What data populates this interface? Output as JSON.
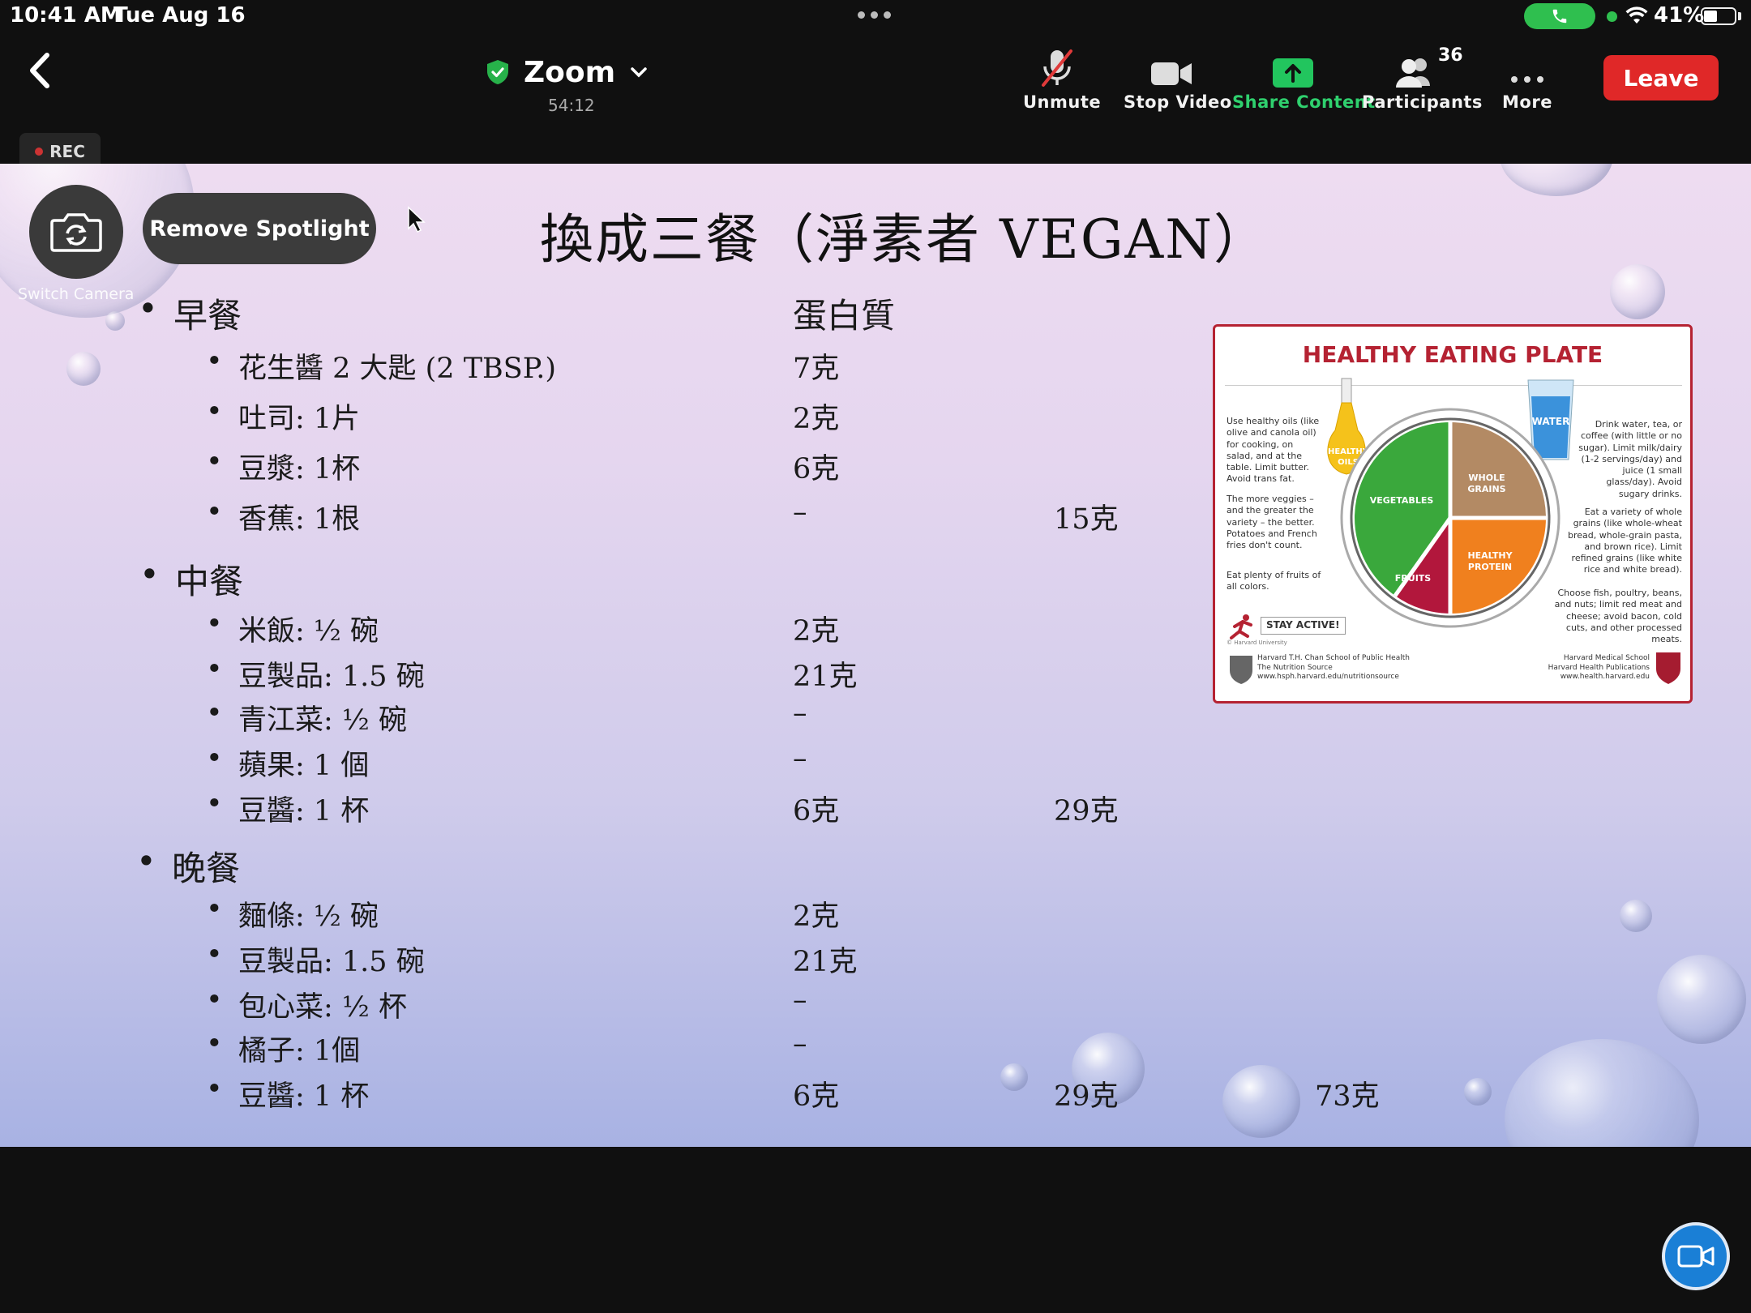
{
  "status_bar": {
    "time": "10:41 AM",
    "date": "Tue Aug 16",
    "battery": "41%"
  },
  "toolbar": {
    "meeting_name": "Zoom",
    "timer": "54:12",
    "unmute": "Unmute",
    "stop_video": "Stop Video",
    "share_content": "Share Content",
    "participants": "Participants",
    "participant_count": "36",
    "more": "More",
    "leave": "Leave"
  },
  "rec": "REC",
  "overlay": {
    "switch_camera": "Switch Camera",
    "remove_spotlight": "Remove Spotlight"
  },
  "slide": {
    "title": "換成三餐（淨素者 VEGAN）",
    "protein_header": "蛋白質",
    "meals": [
      {
        "name": "早餐",
        "items": [
          {
            "label": "花生醬 2 大匙 (2 TBSP.)",
            "protein": "7克"
          },
          {
            "label": "吐司: 1片",
            "protein": "2克"
          },
          {
            "label": "豆漿: 1杯",
            "protein": "6克"
          },
          {
            "label": "香蕉: 1根",
            "protein": "–"
          }
        ],
        "subtotal": "15克"
      },
      {
        "name": "中餐",
        "items": [
          {
            "label": "米飯: ½ 碗",
            "protein": "2克"
          },
          {
            "label": "豆製品: 1.5 碗",
            "protein": "21克"
          },
          {
            "label": "青江菜: ½ 碗",
            "protein": "–"
          },
          {
            "label": "蘋果: 1 個",
            "protein": "–"
          },
          {
            "label": "豆醬: 1 杯",
            "protein": "6克"
          }
        ],
        "subtotal": "29克"
      },
      {
        "name": "晚餐",
        "items": [
          {
            "label": "麵條: ½ 碗",
            "protein": "2克"
          },
          {
            "label": "豆製品: 1.5 碗",
            "protein": "21克"
          },
          {
            "label": "包心菜: ½ 杯",
            "protein": "–"
          },
          {
            "label": "橘子: 1個",
            "protein": "–"
          },
          {
            "label": "豆醬: 1 杯",
            "protein": "6克"
          }
        ],
        "subtotal": "29克"
      }
    ],
    "total": "73克",
    "plate": {
      "title": "HEALTHY EATING PLATE",
      "oils_label": "HEALTHY OILS",
      "water_label": "WATER",
      "veg_label": "VEGETABLES",
      "grains_label": "WHOLE GRAINS",
      "fruits_label": "FRUITS",
      "protein_label": "HEALTHY PROTEIN",
      "oils_text": "Use healthy oils (like olive and canola oil) for cooking, on salad, and at the table. Limit butter. Avoid trans fat.",
      "veggies_text": "The more veggies – and the greater the variety – the better. Potatoes and French fries don't count.",
      "fruits_text": "Eat plenty of fruits of all colors.",
      "water_text": "Drink water, tea, or coffee (with little or no sugar). Limit milk/dairy (1-2 servings/day) and juice (1 small glass/day). Avoid sugary drinks.",
      "grains_text": "Eat a variety of whole grains (like whole-wheat bread, whole-grain pasta, and brown rice). Limit refined grains (like white rice and white bread).",
      "protein_text": "Choose fish, poultry, beans, and nuts; limit red meat and cheese; avoid bacon, cold cuts, and other processed meats.",
      "stay_active": "STAY ACTIVE!",
      "copyright": "© Harvard University",
      "footer_left": "Harvard T.H. Chan School of Public Health\nThe Nutrition Source\nwww.hsph.harvard.edu/nutritionsource",
      "footer_right": "Harvard Medical School\nHarvard Health Publications\nwww.health.harvard.edu"
    }
  },
  "colors": {
    "leave": "#e02828",
    "share": "#2fd06e",
    "rec_dot": "#cc3333",
    "plate_border": "#b52232"
  }
}
